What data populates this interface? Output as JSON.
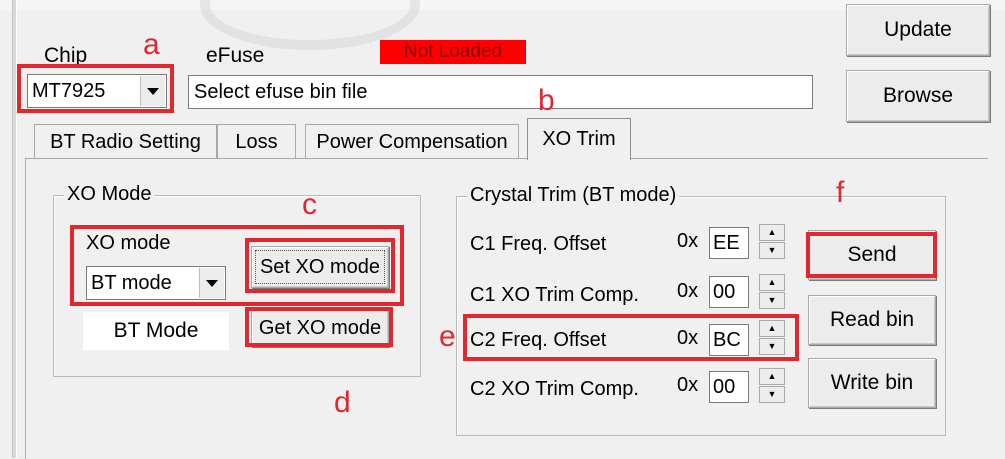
{
  "header": {
    "chip_label": "Chip",
    "chip_value": "MT7925",
    "efuse_label": "eFuse",
    "status_badge": "Not Loaded",
    "efuse_path": "Select efuse bin file",
    "update_button": "Update",
    "browse_button": "Browse"
  },
  "tabs": [
    "BT Radio Setting",
    "Loss",
    "Power Compensation",
    "XO Trim"
  ],
  "xo_mode_group": {
    "title": "XO Mode",
    "mode_label": "XO mode",
    "mode_select": "BT mode",
    "set_button": "Set XO mode",
    "get_button": "Get XO mode",
    "current_mode": "BT Mode"
  },
  "crystal_group": {
    "title": "Crystal Trim (BT mode)",
    "rows": [
      {
        "label": "C1 Freq. Offset",
        "prefix": "0x",
        "value": "EE"
      },
      {
        "label": "C1 XO Trim Comp.",
        "prefix": "0x",
        "value": "00"
      },
      {
        "label": "C2 Freq. Offset",
        "prefix": "0x",
        "value": "BC"
      },
      {
        "label": "C2 XO Trim Comp.",
        "prefix": "0x",
        "value": "00"
      }
    ],
    "send_button": "Send",
    "read_button": "Read bin",
    "write_button": "Write bin"
  },
  "annotations": {
    "a": "a",
    "b": "b",
    "c": "c",
    "d": "d",
    "e": "e",
    "f": "f"
  },
  "colors": {
    "highlight_red": "#e0282e",
    "status_red": "#ff0000"
  }
}
